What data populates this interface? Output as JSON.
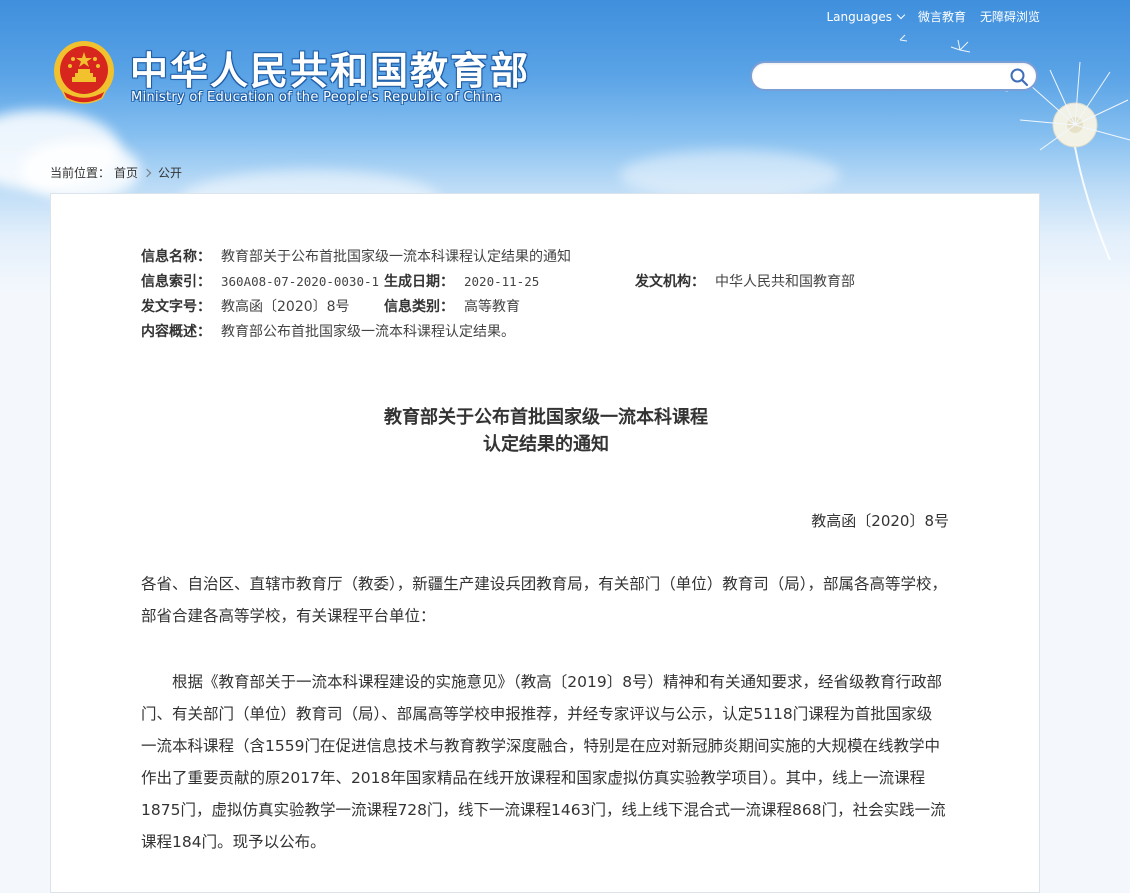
{
  "header": {
    "languages_label": "Languages",
    "weibo_label": "微言教育",
    "accessibility_label": "无障碍浏览",
    "brand_cn": "中华人民共和国教育部",
    "brand_en": "Ministry of Education of the People's Republic of China",
    "search_placeholder": ""
  },
  "breadcrumb": {
    "prefix": "当前位置：",
    "home": "首页",
    "current": "公开"
  },
  "info": {
    "name_label": "信息名称：",
    "name_value": "教育部关于公布首批国家级一流本科课程认定结果的通知",
    "index_label": "信息索引：",
    "index_value": "360A08-07-2020-0030-1",
    "date_label": "生成日期：",
    "date_value": "2020-11-25",
    "org_label": "发文机构：",
    "org_value": "中华人民共和国教育部",
    "doc_no_label": "发文字号：",
    "doc_no_value": "教高函〔2020〕8号",
    "category_label": "信息类别：",
    "category_value": "高等教育",
    "summary_label": "内容概述：",
    "summary_value": "教育部公布首批国家级一流本科课程认定结果。"
  },
  "document": {
    "title_line1": "教育部关于公布首批国家级一流本科课程",
    "title_line2": "认定结果的通知",
    "doc_number": "教高函〔2020〕8号",
    "paragraph1": "各省、自治区、直辖市教育厅（教委），新疆生产建设兵团教育局，有关部门（单位）教育司（局），部属各高等学校，部省合建各高等学校，有关课程平台单位：",
    "paragraph2": "根据《教育部关于一流本科课程建设的实施意见》（教高〔2019〕8号）精神和有关通知要求，经省级教育行政部门、有关部门（单位）教育司（局）、部属高等学校申报推荐，并经专家评议与公示，认定5118门课程为首批国家级一流本科课程（含1559门在促进信息技术与教育教学深度融合，特别是在应对新冠肺炎期间实施的大规模在线教学中作出了重要贡献的原2017年、2018年国家精品在线开放课程和国家虚拟仿真实验教学项目）。其中，线上一流课程1875门，虚拟仿真实验教学一流课程728门，线下一流课程1463门，线上线下混合式一流课程868门，社会实践一流课程184门。现予以公布。"
  },
  "colors": {
    "header_blue": "#3f8fdd",
    "emblem_red": "#d7261e",
    "emblem_gold": "#f2c12e",
    "text": "#333333"
  }
}
